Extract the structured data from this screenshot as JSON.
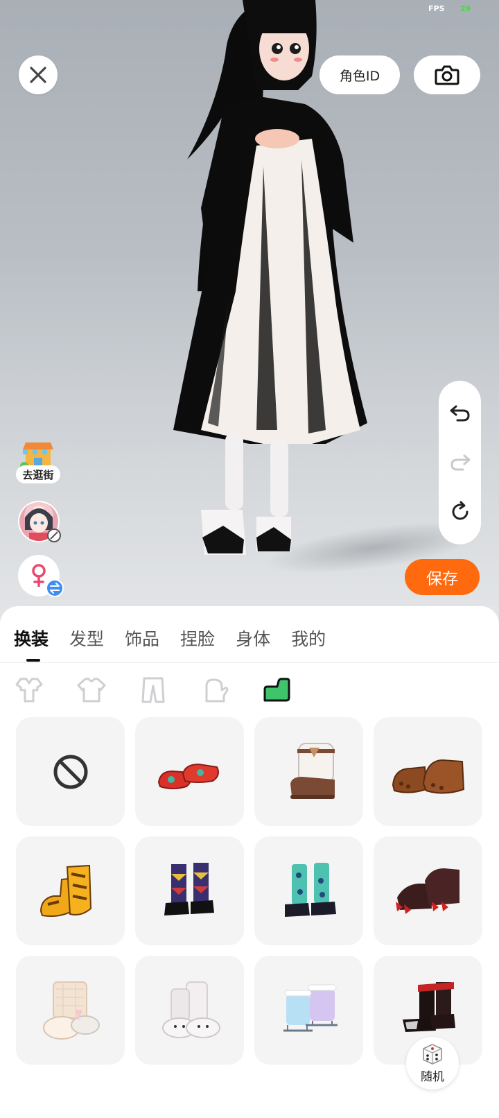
{
  "status": {
    "fps_label": "FPS",
    "fps_value": "29"
  },
  "top_bar": {
    "role_id_label": "角色ID"
  },
  "actions": {
    "save_label": "保存",
    "street_label": "去逛街",
    "random_label": "随机"
  },
  "tabs": {
    "main": [
      {
        "label": "换装",
        "active": true
      },
      {
        "label": "发型",
        "active": false
      },
      {
        "label": "饰品",
        "active": false
      },
      {
        "label": "捏脸",
        "active": false
      },
      {
        "label": "身体",
        "active": false
      },
      {
        "label": "我的",
        "active": false
      }
    ],
    "sub": [
      {
        "icon": "outfit-set-icon",
        "active": false
      },
      {
        "icon": "top-icon",
        "active": false
      },
      {
        "icon": "pants-icon",
        "active": false
      },
      {
        "icon": "glove-icon",
        "active": false
      },
      {
        "icon": "shoe-icon",
        "active": true
      }
    ]
  },
  "items": [
    {
      "name": "none"
    },
    {
      "name": "red-flat-shoes",
      "color": "#d9302a"
    },
    {
      "name": "brown-fur-boots",
      "color": "#7a4a35"
    },
    {
      "name": "brown-paw-slippers",
      "color": "#8c4a22"
    },
    {
      "name": "yellow-tiger-boots",
      "color": "#f0a818"
    },
    {
      "name": "argyle-boots",
      "color": "#3a2f6e"
    },
    {
      "name": "teal-patterned-boots",
      "color": "#4fc1b0"
    },
    {
      "name": "dark-claw-shoes",
      "color": "#3b1d1d"
    },
    {
      "name": "bunny-slippers-beige",
      "color": "#f3e3d3"
    },
    {
      "name": "bunny-slippers-white",
      "color": "#efefef"
    },
    {
      "name": "holographic-skates",
      "color": "#b8e0f4"
    },
    {
      "name": "black-red-boots",
      "color": "#2a1a1a"
    }
  ],
  "colors": {
    "accent": "#ff6a0f",
    "swap_badge": "#3d8ef5",
    "female_icon": "#e8486e",
    "shoe_tab_active": "#3fc36b"
  }
}
